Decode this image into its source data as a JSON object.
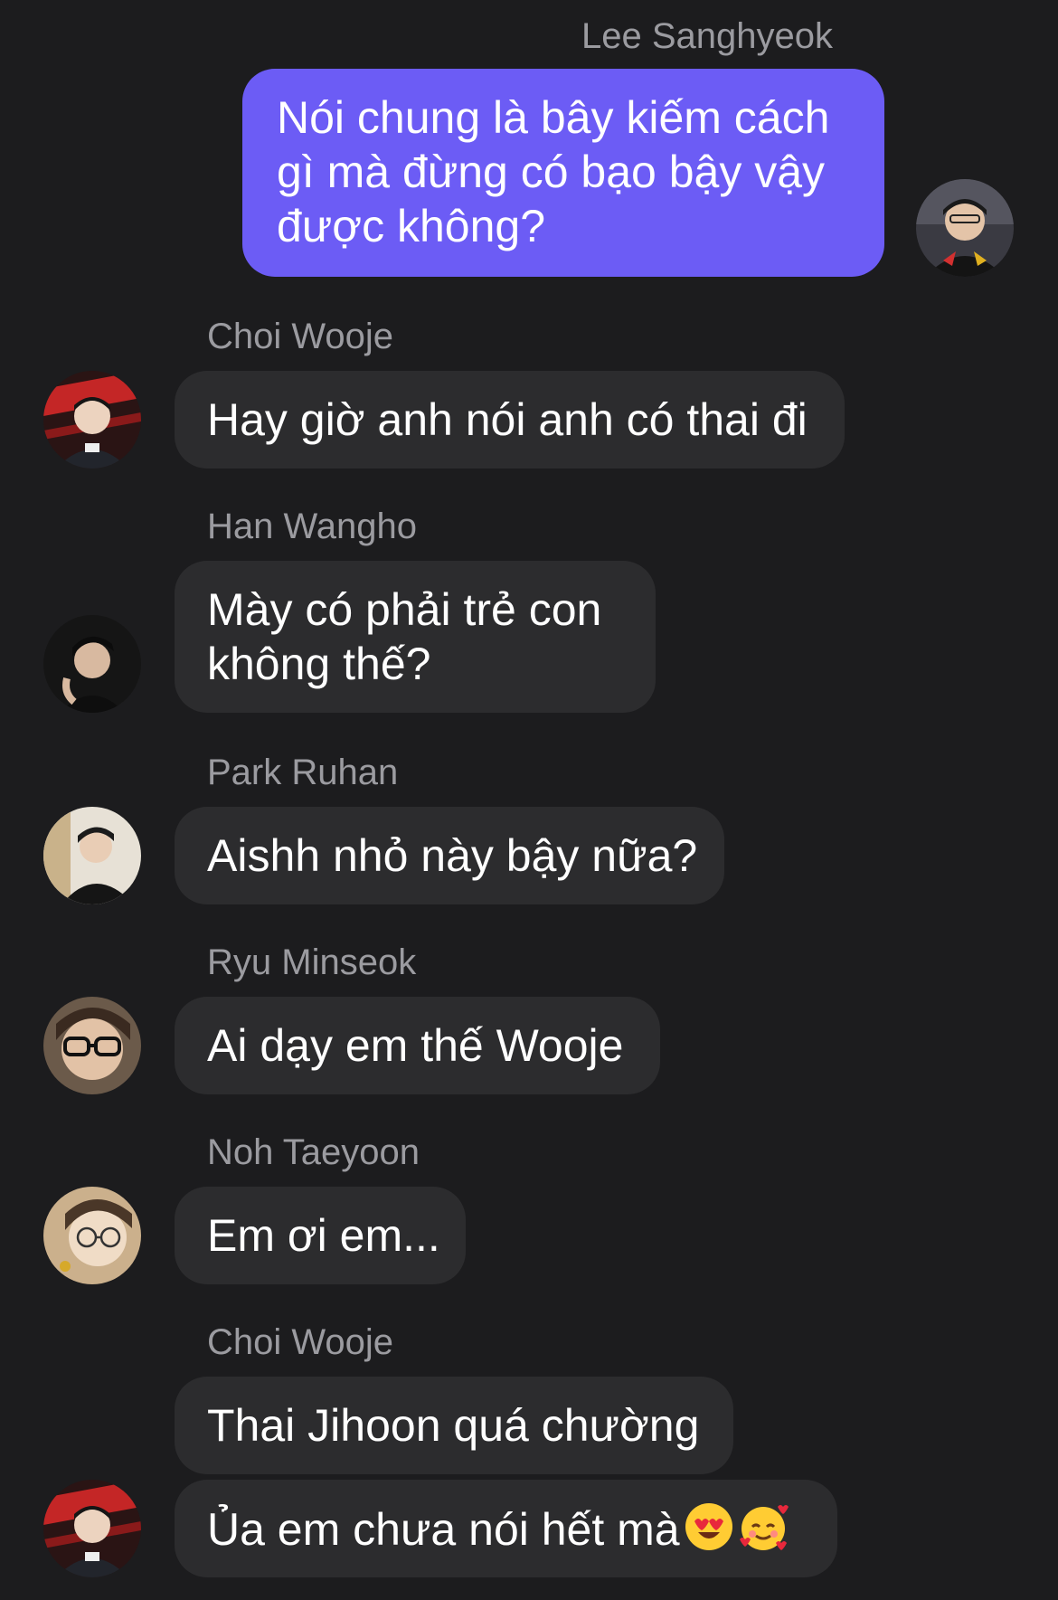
{
  "messages": [
    {
      "sender": "Lee Sanghyeok",
      "lines": [
        "Nói chung là bây kiếm cách",
        "gì mà đừng có bạo bậy vậy",
        "được không?"
      ]
    },
    {
      "sender": "Choi Wooje",
      "lines": [
        "Hay giờ anh nói anh có thai đi"
      ]
    },
    {
      "sender": "Han Wangho",
      "lines": [
        "Mày có phải trẻ con",
        "không thế?"
      ]
    },
    {
      "sender": "Park Ruhan",
      "lines": [
        "Aishh nhỏ này bậy nữa?"
      ]
    },
    {
      "sender": "Ryu Minseok",
      "lines": [
        "Ai dạy em thế Wooje"
      ]
    },
    {
      "sender": "Noh Taeyoon",
      "lines": [
        "Em ơi em..."
      ]
    },
    {
      "sender": "Choi Wooje",
      "lines": [
        "Thai Jihoon quá chường"
      ]
    },
    {
      "sender": "",
      "lines": [
        "Ủa em chưa nói hết mà"
      ],
      "emojis": [
        "heart-eyes-emoji",
        "smiling-hearts-emoji"
      ]
    }
  ],
  "colors": {
    "background": "#1c1c1e",
    "incoming_bubble": "#2c2c2e",
    "outgoing_bubble": "#6c5cf5",
    "sender_name": "#9b9ba0"
  }
}
